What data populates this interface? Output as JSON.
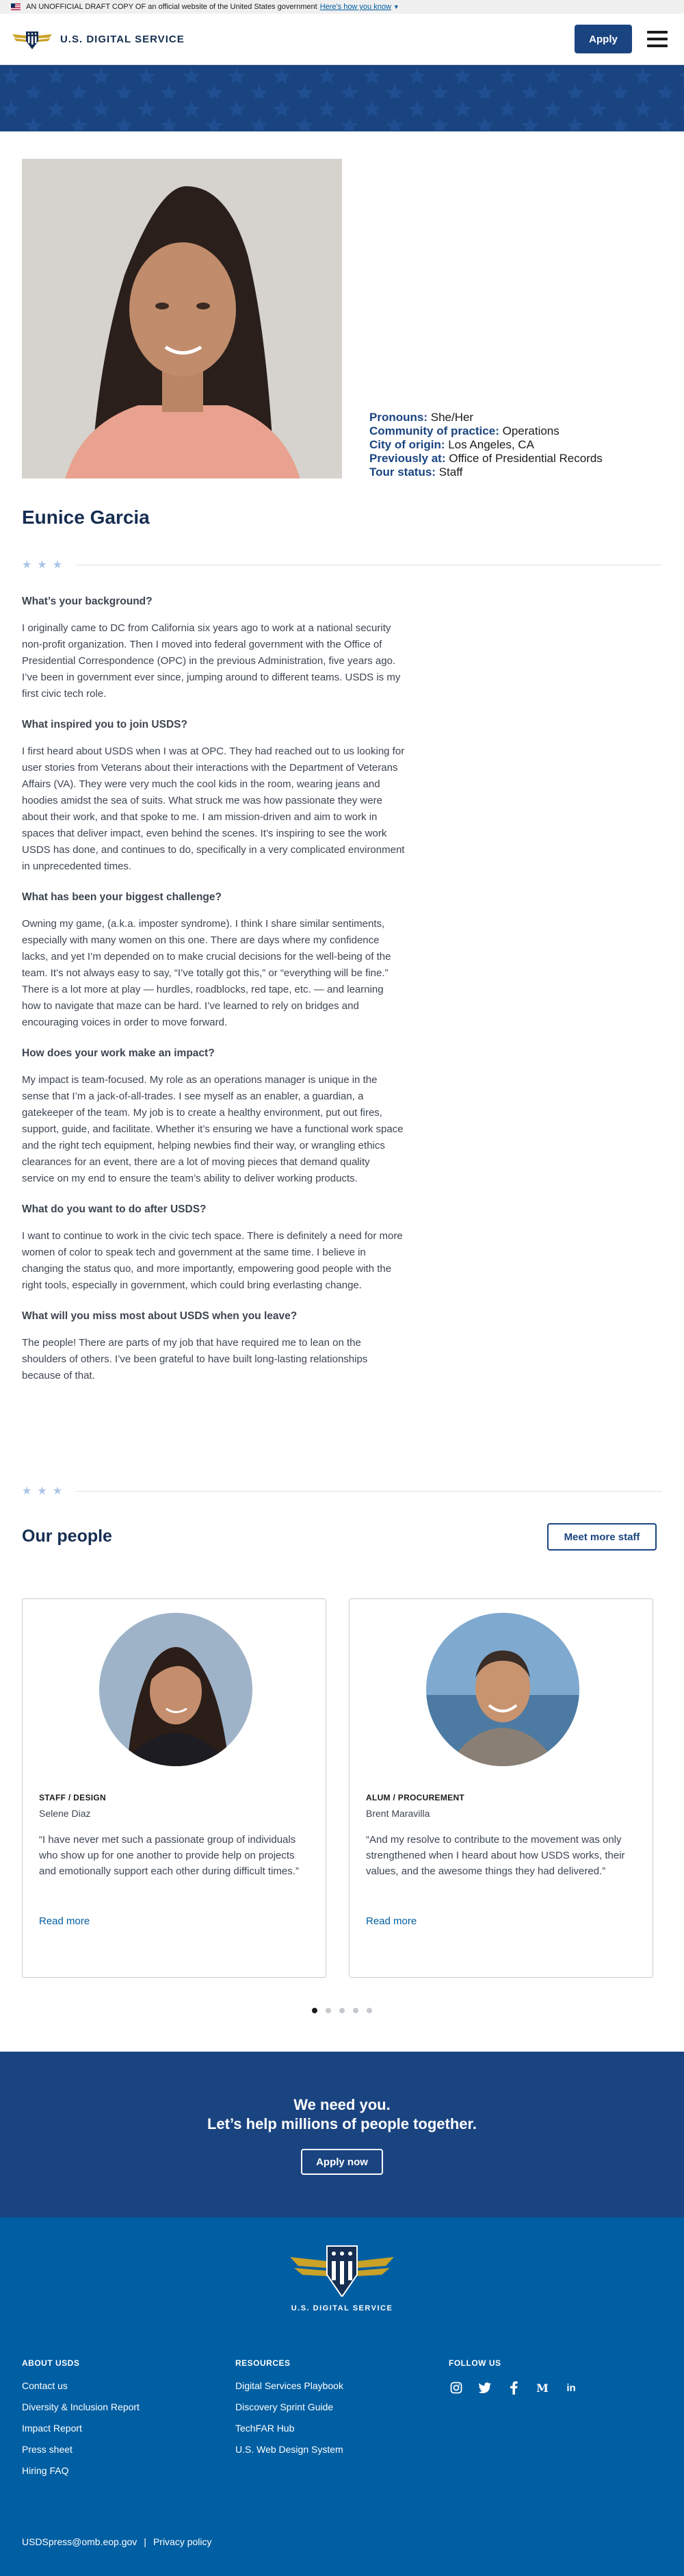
{
  "banner": {
    "text": "AN UNOFFICIAL DRAFT COPY OF an official website of the United States government",
    "link": "Here's how you know",
    "chevron": "chevron-down-icon"
  },
  "header": {
    "logo_text": "U.S. DIGITAL SERVICE",
    "apply_label": "Apply",
    "menu_icon": "hamburger-icon"
  },
  "colors": {
    "primary_dark": "#1a4480",
    "navy": "#162e51",
    "link": "#005ea2",
    "footer": "#005ea2"
  },
  "profile": {
    "name": "Eunice Garcia",
    "facts": [
      {
        "label": "Pronouns:",
        "value": "She/Her"
      },
      {
        "label": "Community of practice:",
        "value": "Operations"
      },
      {
        "label": "City of origin:",
        "value": "Los Angeles, CA"
      },
      {
        "label": "Previously at:",
        "value": "Office of Presidential Records"
      },
      {
        "label": "Tour status:",
        "value": "Staff"
      }
    ],
    "qa": [
      {
        "q": "What’s your background?",
        "a": "I originally came to DC from California six years ago to work at a national security non-profit organization. Then I moved into federal government with the Office of Presidential Correspondence (OPC) in the previous Administration, five years ago. I’ve been in government ever since, jumping around to different teams. USDS is my first civic tech role."
      },
      {
        "q": "What inspired you to join USDS?",
        "a": "I first heard about USDS when I was at OPC. They had reached out to us looking for user stories from Veterans about their interactions with the Department of Veterans Affairs (VA). They were very much the cool kids in the room, wearing jeans and hoodies amidst the sea of suits. What struck me was how passionate they were about their work, and that spoke to me. I am mission-driven and aim to work in spaces that deliver impact, even behind the scenes. It’s inspiring to see the work USDS has done, and continues to do, specifically in a very complicated environment in unprecedented times."
      },
      {
        "q": "What has been your biggest challenge?",
        "a": "Owning my game, (a.k.a. imposter syndrome). I think I share similar sentiments, especially with many women on this one. There are days where my confidence lacks, and yet I’m depended on to make crucial decisions for the well-being of the team. It’s not always easy to say, “I’ve totally got this,” or “everything will be fine.” There is a lot more at play — hurdles, roadblocks, red tape, etc. — and learning how to navigate that maze can be hard. I’ve learned to rely on bridges and encouraging voices in order to move forward."
      },
      {
        "q": "How does your work make an impact?",
        "a": "My impact is team-focused. My role as an operations manager is unique in the sense that I’m a jack-of-all-trades. I see myself as an enabler, a guardian, a gatekeeper of the team. My job is to create a healthy environment, put out fires, support, guide, and facilitate. Whether it’s ensuring we have a functional work space and the right tech equipment, helping newbies find their way, or wrangling ethics clearances for an event, there are a lot of moving pieces that demand quality service on my end to ensure the team’s ability to deliver working products."
      },
      {
        "q": "What do you want to do after USDS?",
        "a": "I want to continue to work in the civic tech space. There is definitely a need for more women of color to speak tech and government at the same time. I believe in changing the status quo, and more importantly, empowering good people with the right tools, especially in government, which could bring everlasting change."
      },
      {
        "q": "What will you miss most about USDS when you leave?",
        "a": "The people! There are parts of my job that have required me to lean on the shoulders of others. I’ve been grateful to have built long-lasting relationships because of that."
      }
    ]
  },
  "people": {
    "title": "Our people",
    "meet_more_label": "Meet more staff",
    "cards": [
      {
        "role": "STAFF / DESIGN",
        "name": "Selene Diaz",
        "quote": "“I have never met such a passionate group of individuals who show up for one another to provide help on projects and emotionally support each other during difficult times.”",
        "link": "Read more"
      },
      {
        "role": "ALUM / PROCUREMENT",
        "name": "Brent Maravilla",
        "quote": "“And my resolve to contribute to the movement was only strengthened when I heard about how USDS works, their values, and the awesome things they had delivered.”",
        "link": "Read more"
      }
    ],
    "carousel_pages": 5,
    "carousel_active": 1
  },
  "cta": {
    "line1": "We need you.",
    "line2": "Let’s help millions of people together.",
    "button": "Apply now"
  },
  "footer": {
    "logo_text": "U.S. DIGITAL SERVICE",
    "about": {
      "heading": "ABOUT USDS",
      "links": [
        "Contact us",
        "Diversity & Inclusion Report",
        "Impact Report",
        "Press sheet",
        "Hiring FAQ"
      ]
    },
    "resources": {
      "heading": "RESOURCES",
      "links": [
        "Digital Services Playbook",
        "Discovery Sprint Guide",
        "TechFAR Hub",
        "U.S. Web Design System"
      ]
    },
    "follow": {
      "heading": "FOLLOW US",
      "icons": [
        "instagram-icon",
        "twitter-icon",
        "facebook-icon",
        "medium-icon",
        "linkedin-icon"
      ]
    },
    "email": "USDSpress@omb.eop.gov",
    "separator": "|",
    "privacy": "Privacy policy"
  }
}
